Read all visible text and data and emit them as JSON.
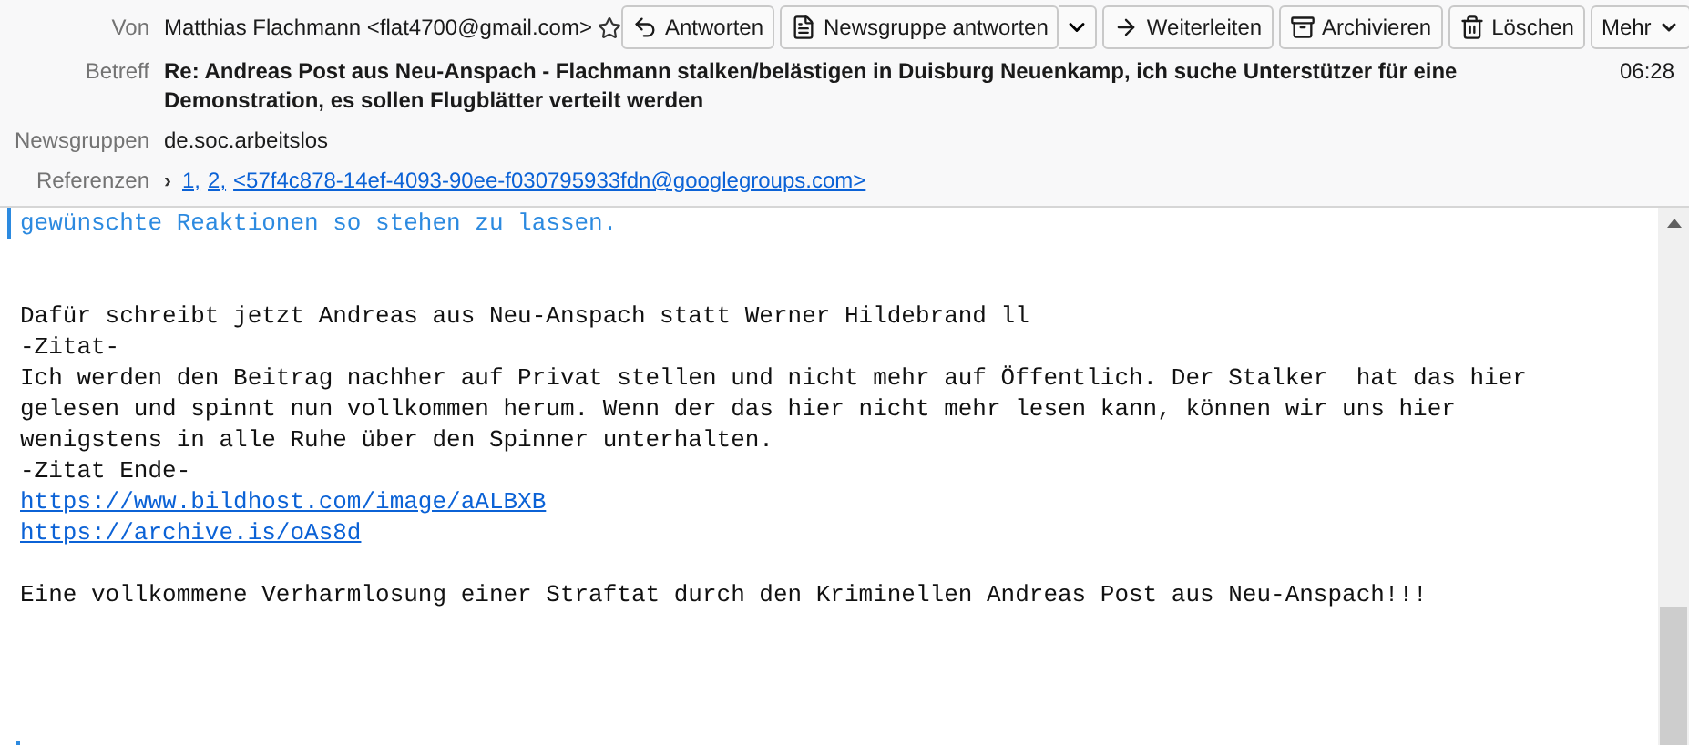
{
  "header": {
    "from": {
      "label": "Von",
      "value": "Matthias Flachmann <flat4700@gmail.com>",
      "starred": false
    },
    "buttons": [
      {
        "kind": "reply",
        "label": "Antworten"
      },
      {
        "kind": "group_reply",
        "label": "Newsgruppe antworten",
        "dropdown": true
      },
      {
        "kind": "forward",
        "label": "Weiterleiten"
      },
      {
        "kind": "archive",
        "label": "Archivieren"
      },
      {
        "kind": "delete",
        "label": "Löschen"
      },
      {
        "kind": "more",
        "label": "Mehr"
      }
    ],
    "subject": {
      "label": "Betreff",
      "value": "Re: Andreas Post aus Neu-Anspach - Flachmann stalken/belästigen in Duisburg Neuenkamp, ich suche Unterstützer für eine Demonstration, es sollen Flugblätter verteilt werden",
      "time": "06:28"
    },
    "newsgroups": {
      "label": "Newsgruppen",
      "value": "de.soc.arbeitslos"
    },
    "references": {
      "label": "Referenzen",
      "toggle": "›",
      "links": [
        "1,",
        "2,",
        "<57f4c878-14ef-4093-90ee-f030795933fdn@googlegroups.com>"
      ]
    }
  },
  "body": [
    {
      "kind": "quote",
      "text": "gewünschte Reaktionen so stehen zu lassen."
    },
    {
      "kind": "blank"
    },
    {
      "kind": "blank"
    },
    {
      "kind": "text",
      "text": "Dafür schreibt jetzt Andreas aus Neu-Anspach statt Werner Hildebrand ll"
    },
    {
      "kind": "text",
      "text": "-Zitat-"
    },
    {
      "kind": "text",
      "text": "Ich werden den Beitrag nachher auf Privat stellen und nicht mehr auf Öffentlich. Der Stalker  hat das hier"
    },
    {
      "kind": "text",
      "text": "gelesen und spinnt nun vollkommen herum. Wenn der das hier nicht mehr lesen kann, können wir uns hier"
    },
    {
      "kind": "text",
      "text": "wenigstens in alle Ruhe über den Spinner unterhalten."
    },
    {
      "kind": "text",
      "text": "-Zitat Ende-"
    },
    {
      "kind": "link",
      "text": "https://www.bildhost.com/image/aALBXB"
    },
    {
      "kind": "link",
      "text": "https://archive.is/oAs8d"
    },
    {
      "kind": "blank"
    },
    {
      "kind": "text",
      "text": "Eine vollkommene Verharmlosung einer Straftat durch den Kriminellen Andreas Post aus Neu-Anspach!!!"
    },
    {
      "kind": "blank"
    },
    {
      "kind": "blank"
    },
    {
      "kind": "blank"
    },
    {
      "kind": "blank"
    },
    {
      "kind": "quote_start"
    }
  ]
}
